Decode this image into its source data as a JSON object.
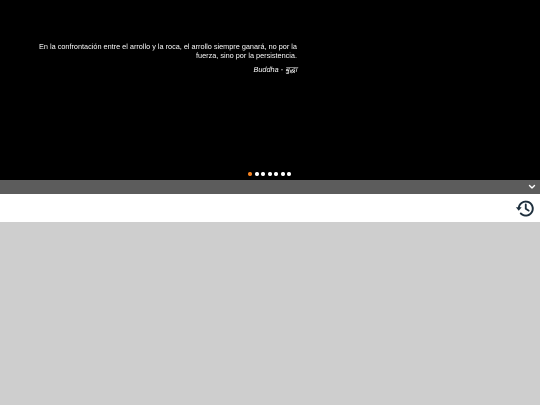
{
  "quote": {
    "text": "En la confrontación entre el arrollo y la roca, el arrollo siempre ganará, no por la fuerza, sino por la persistencia.",
    "author": "Buddha - बुद्धा"
  },
  "carousel": {
    "slide_count": 7,
    "active_index": 0,
    "active_color": "#f58220",
    "inactive_color": "#ffffff"
  },
  "toggle_bar": {
    "icon": "chevron-down-icon"
  },
  "toolbar": {
    "icon": "history-icon",
    "icon_color": "#1e2f3d"
  },
  "colors": {
    "hero_background": "#000000",
    "toggle_bar_background": "#5c5c5c",
    "toolbar_background": "#ffffff",
    "page_background": "#cecece"
  }
}
